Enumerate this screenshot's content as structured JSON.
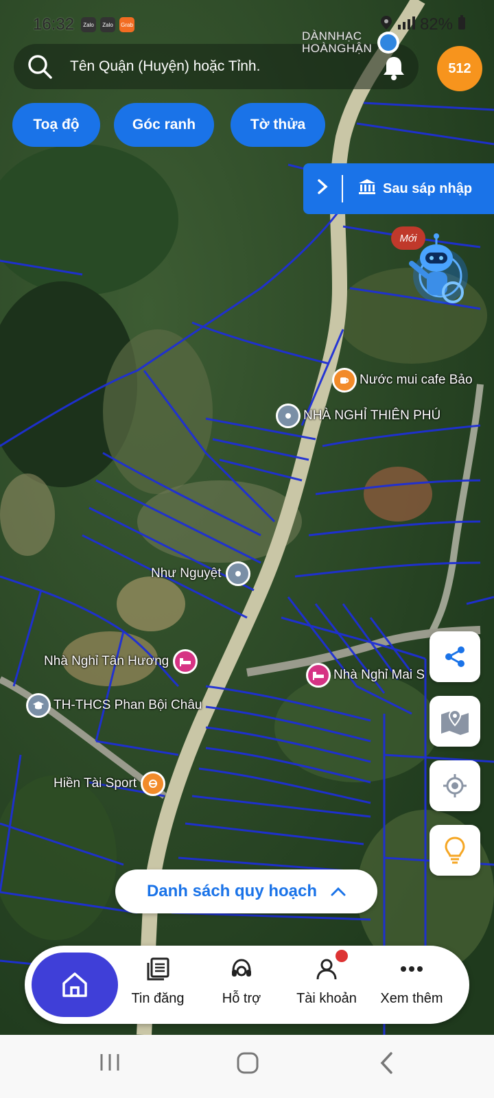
{
  "status_bar": {
    "time": "16:32",
    "battery": "82%",
    "app_icons": [
      "Zalo",
      "Zalo",
      "Grab"
    ]
  },
  "search": {
    "placeholder": "Tên Quận (Huyện) hoặc Tỉnh."
  },
  "notification_count": "512",
  "map_overlay_label": {
    "line1": "DÀNNHẠC",
    "line2": "HOÀNGHẬN"
  },
  "chips": [
    "Toạ độ",
    "Góc ranh",
    "Tờ thửa"
  ],
  "merge_button": {
    "label": "Sau sáp nhập"
  },
  "assistant": {
    "badge": "Mới"
  },
  "pois": [
    {
      "name": "Nước mui cafe Bảo",
      "type": "cafe"
    },
    {
      "name": "NHÀ NGHỈ THIÊN PHÚ",
      "type": "place"
    },
    {
      "name": "Như Nguyệt",
      "type": "place"
    },
    {
      "name": "Nhà Nghỉ Tân Hương",
      "type": "hotel"
    },
    {
      "name": "Nhà Nghỉ Mai S",
      "type": "hotel"
    },
    {
      "name": "TH-THCS Phan Bội Châu",
      "type": "school"
    },
    {
      "name": "Hiền Tài Sport",
      "type": "sport"
    }
  ],
  "plan_list": {
    "label": "Danh sách quy hoạch"
  },
  "bottom_nav": {
    "items": [
      {
        "label": "Tin đăng",
        "icon": "listing-icon"
      },
      {
        "label": "Hỗ trợ",
        "icon": "support-icon"
      },
      {
        "label": "Tài khoản",
        "icon": "account-icon"
      },
      {
        "label": "Xem thêm",
        "icon": "more-icon"
      }
    ]
  },
  "colors": {
    "accent": "#1a73e8",
    "home": "#3f3fd8",
    "badge": "#f7941d",
    "parcel_lines": "#1e2fd6"
  }
}
